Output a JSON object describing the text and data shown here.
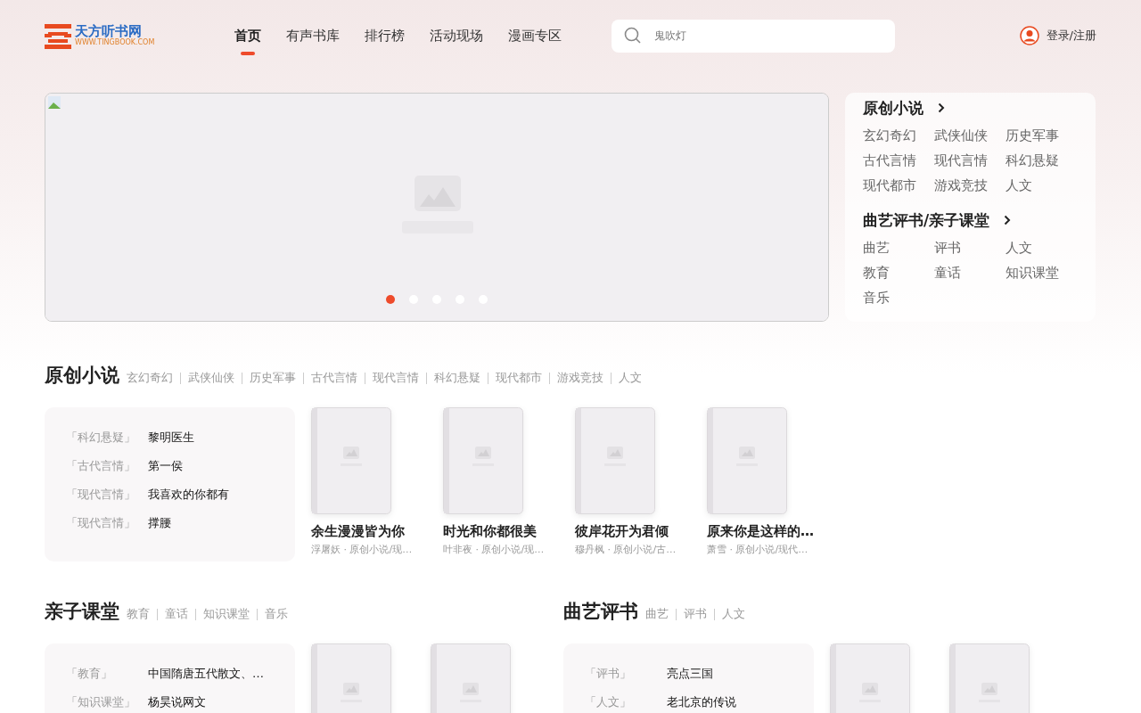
{
  "header": {
    "logo": {
      "name": "天方听书网",
      "url": "WWW.TINGBOOK.COM"
    },
    "nav": [
      {
        "label": "首页",
        "selected": true
      },
      {
        "label": "有声书库",
        "selected": false
      },
      {
        "label": "排行榜",
        "selected": false
      },
      {
        "label": "活动现场",
        "selected": false
      },
      {
        "label": "漫画专区",
        "selected": false
      }
    ],
    "search": {
      "placeholder": "鬼吹灯"
    },
    "login": "登录/注册"
  },
  "banner": {
    "dots": [
      {
        "selected": true
      },
      {
        "selected": false
      },
      {
        "selected": false
      },
      {
        "selected": false
      },
      {
        "selected": false
      }
    ]
  },
  "category_panel": {
    "groups": [
      {
        "title": "原创小说",
        "items": [
          "玄幻奇幻",
          "武侠仙侠",
          "历史军事",
          "古代言情",
          "现代言情",
          "科幻悬疑",
          "现代都市",
          "游戏竞技",
          "人文"
        ]
      },
      {
        "title": "曲艺评书/亲子课堂",
        "items": [
          "曲艺",
          "评书",
          "人文",
          "教育",
          "童话",
          "知识课堂",
          "音乐"
        ]
      }
    ]
  },
  "sections": [
    {
      "title": "原创小说",
      "tags": [
        "玄幻奇幻",
        "武侠仙侠",
        "历史军事",
        "古代言情",
        "现代言情",
        "科幻悬疑",
        "现代都市",
        "游戏竞技",
        "人文"
      ],
      "list": [
        {
          "tag": "「科幻悬疑」",
          "title": "黎明医生"
        },
        {
          "tag": "「古代言情」",
          "title": "第一侯"
        },
        {
          "tag": "「现代言情」",
          "title": "我喜欢的你都有"
        },
        {
          "tag": "「现代言情」",
          "title": "撑腰"
        }
      ],
      "books": [
        {
          "kind": "cover",
          "title": "余生漫漫皆为你",
          "meta": "浮屠妖 · 原创小说/现…"
        },
        {
          "kind": "cover",
          "title": "时光和你都很美",
          "meta": "叶非夜 · 原创小说/现…"
        },
        {
          "kind": "cover",
          "title": "彼岸花开为君倾",
          "meta": "穆丹枫 · 原创小说/古…"
        },
        {
          "kind": "cover",
          "title": "原来你是这样的…",
          "meta": "萧雪 · 原创小说/现代…"
        }
      ]
    },
    {
      "title": "亲子课堂",
      "tags": [
        "教育",
        "童话",
        "知识课堂",
        "音乐"
      ],
      "list": [
        {
          "tag": "「教育」",
          "title": "中国隋唐五代散文、…"
        },
        {
          "tag": "「知识课堂」",
          "title": "杨昊说网文"
        }
      ],
      "books": [
        {
          "kind": "cover"
        },
        {
          "kind": "cover"
        }
      ]
    },
    {
      "title": "曲艺评书",
      "tags": [
        "曲艺",
        "评书",
        "人文"
      ],
      "list": [
        {
          "tag": "「评书」",
          "title": "亮点三国"
        },
        {
          "tag": "「人文」",
          "title": "老北京的传说"
        }
      ],
      "books": [
        {
          "kind": "cover"
        },
        {
          "kind": "cover"
        }
      ]
    }
  ]
}
